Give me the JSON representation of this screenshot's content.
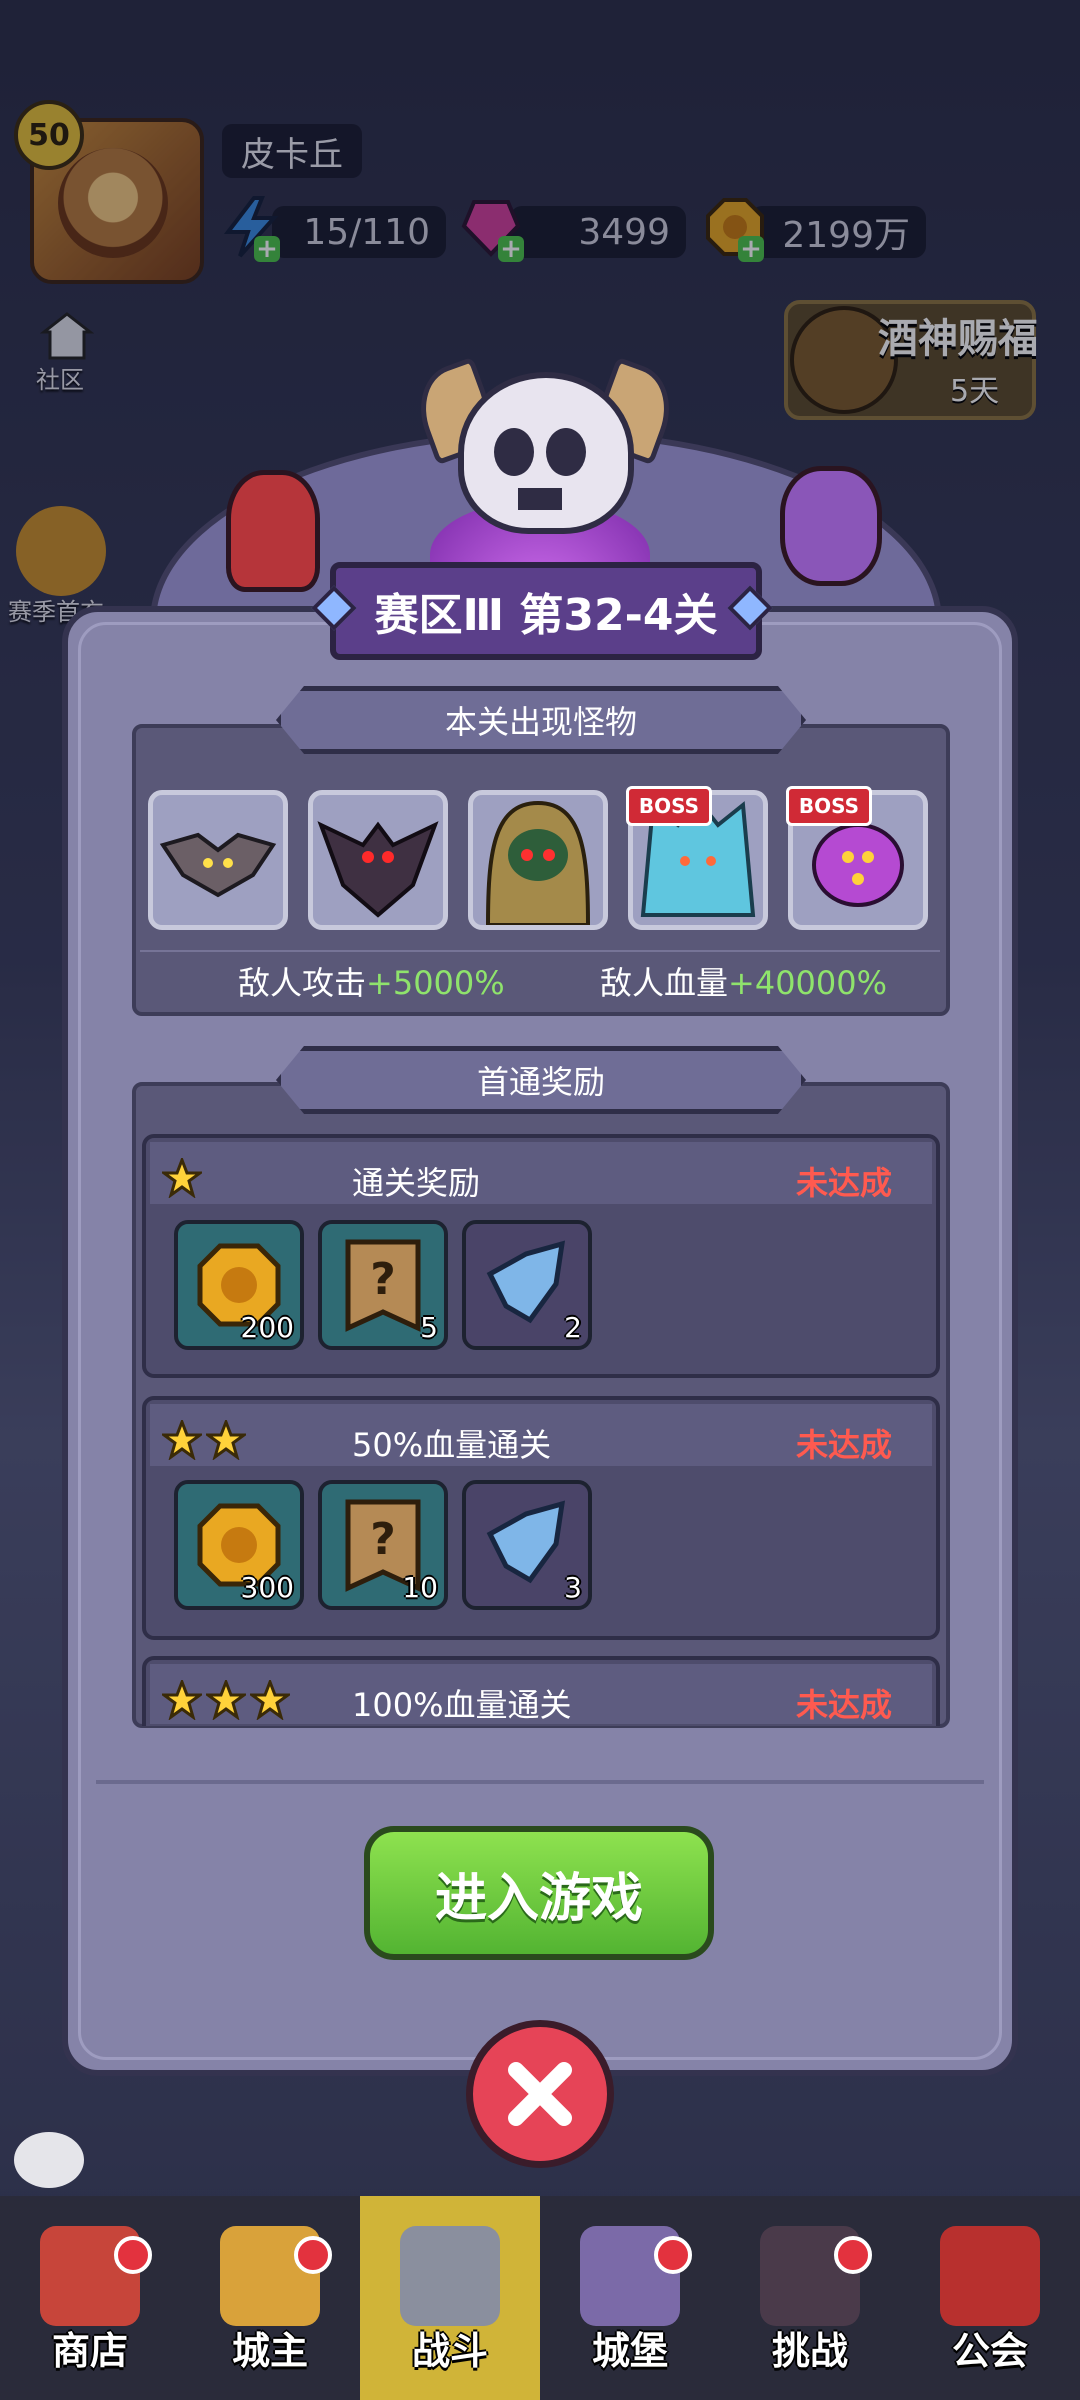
{
  "player": {
    "level": "50",
    "name": "皮卡丘"
  },
  "resources": {
    "energy": "15/110",
    "gems": "3499",
    "gold": "2199万"
  },
  "left_menu": {
    "community": "社区",
    "season": "赛季首充"
  },
  "event": {
    "title": "酒神赐福",
    "days": "5天"
  },
  "dialog": {
    "title": "赛区Ⅲ 第32-4关",
    "monsters_section": "本关出现怪物",
    "monsters": [
      {
        "name": "bat",
        "boss": false
      },
      {
        "name": "demon",
        "boss": false
      },
      {
        "name": "hooded-cultist",
        "boss": false
      },
      {
        "name": "ice-golem",
        "boss": true
      },
      {
        "name": "spider",
        "boss": true
      }
    ],
    "boss_label": "BOSS",
    "enemy_attack_label": "敌人攻击",
    "enemy_attack_value": "+5000%",
    "enemy_hp_label": "敌人血量",
    "enemy_hp_value": "+40000%",
    "rewards_section": "首通奖励",
    "rewards": [
      {
        "stars": 1,
        "title": "通关奖励",
        "status": "未达成",
        "items": [
          {
            "type": "gold-coin",
            "qty": "200"
          },
          {
            "type": "mystery-scroll",
            "qty": "5"
          },
          {
            "type": "crystal",
            "qty": "2"
          }
        ]
      },
      {
        "stars": 2,
        "title": "50%血量通关",
        "status": "未达成",
        "items": [
          {
            "type": "gold-coin",
            "qty": "300"
          },
          {
            "type": "mystery-scroll",
            "qty": "10"
          },
          {
            "type": "crystal",
            "qty": "3"
          }
        ]
      },
      {
        "stars": 3,
        "title": "100%血量通关",
        "status": "未达成",
        "items": []
      }
    ],
    "enter_button": "进入游戏"
  },
  "nav": [
    {
      "label": "商店",
      "badge": true
    },
    {
      "label": "城主",
      "badge": true
    },
    {
      "label": "战斗",
      "badge": false,
      "active": true
    },
    {
      "label": "城堡",
      "badge": true
    },
    {
      "label": "挑战",
      "badge": true
    },
    {
      "label": "公会",
      "badge": false
    }
  ]
}
